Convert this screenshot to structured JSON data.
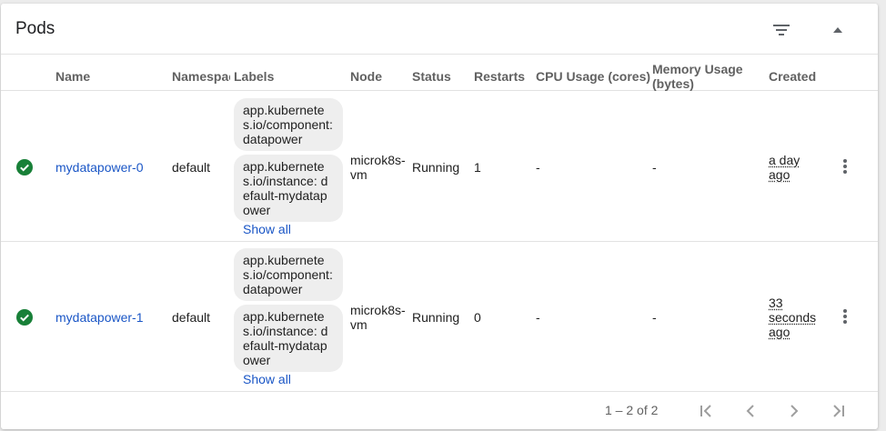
{
  "card": {
    "title": "Pods"
  },
  "header_icons": {
    "filter": "filter-list-icon",
    "collapse": "arrow-drop-up-icon"
  },
  "columns": {
    "name": "Name",
    "namespace": "Namespace",
    "labels": "Labels",
    "node": "Node",
    "status": "Status",
    "restarts": "Restarts",
    "cpu": "CPU Usage (cores)",
    "memory": "Memory Usage (bytes)",
    "created": "Created"
  },
  "rows": [
    {
      "name": "mydatapower-0",
      "namespace": "default",
      "labels": [
        "app.kubernetes.io/component: datapower",
        "app.kubernetes.io/instance: default-mydatapower"
      ],
      "show_all": "Show all",
      "node": "microk8s-vm",
      "status": "Running",
      "restarts": "1",
      "cpu": "-",
      "memory": "-",
      "created": "a day ago",
      "status_icon": "check-circle-icon"
    },
    {
      "name": "mydatapower-1",
      "namespace": "default",
      "labels": [
        "app.kubernetes.io/component: datapower",
        "app.kubernetes.io/instance: default-mydatapower"
      ],
      "show_all": "Show all",
      "node": "microk8s-vm",
      "status": "Running",
      "restarts": "0",
      "cpu": "-",
      "memory": "-",
      "created": "33 seconds ago",
      "status_icon": "check-circle-icon"
    }
  ],
  "pagination": {
    "range": "1 – 2 of 2"
  },
  "colors": {
    "link": "#1a56c6",
    "success": "#188038",
    "chip": "#eeeeee",
    "muted": "#616161"
  }
}
